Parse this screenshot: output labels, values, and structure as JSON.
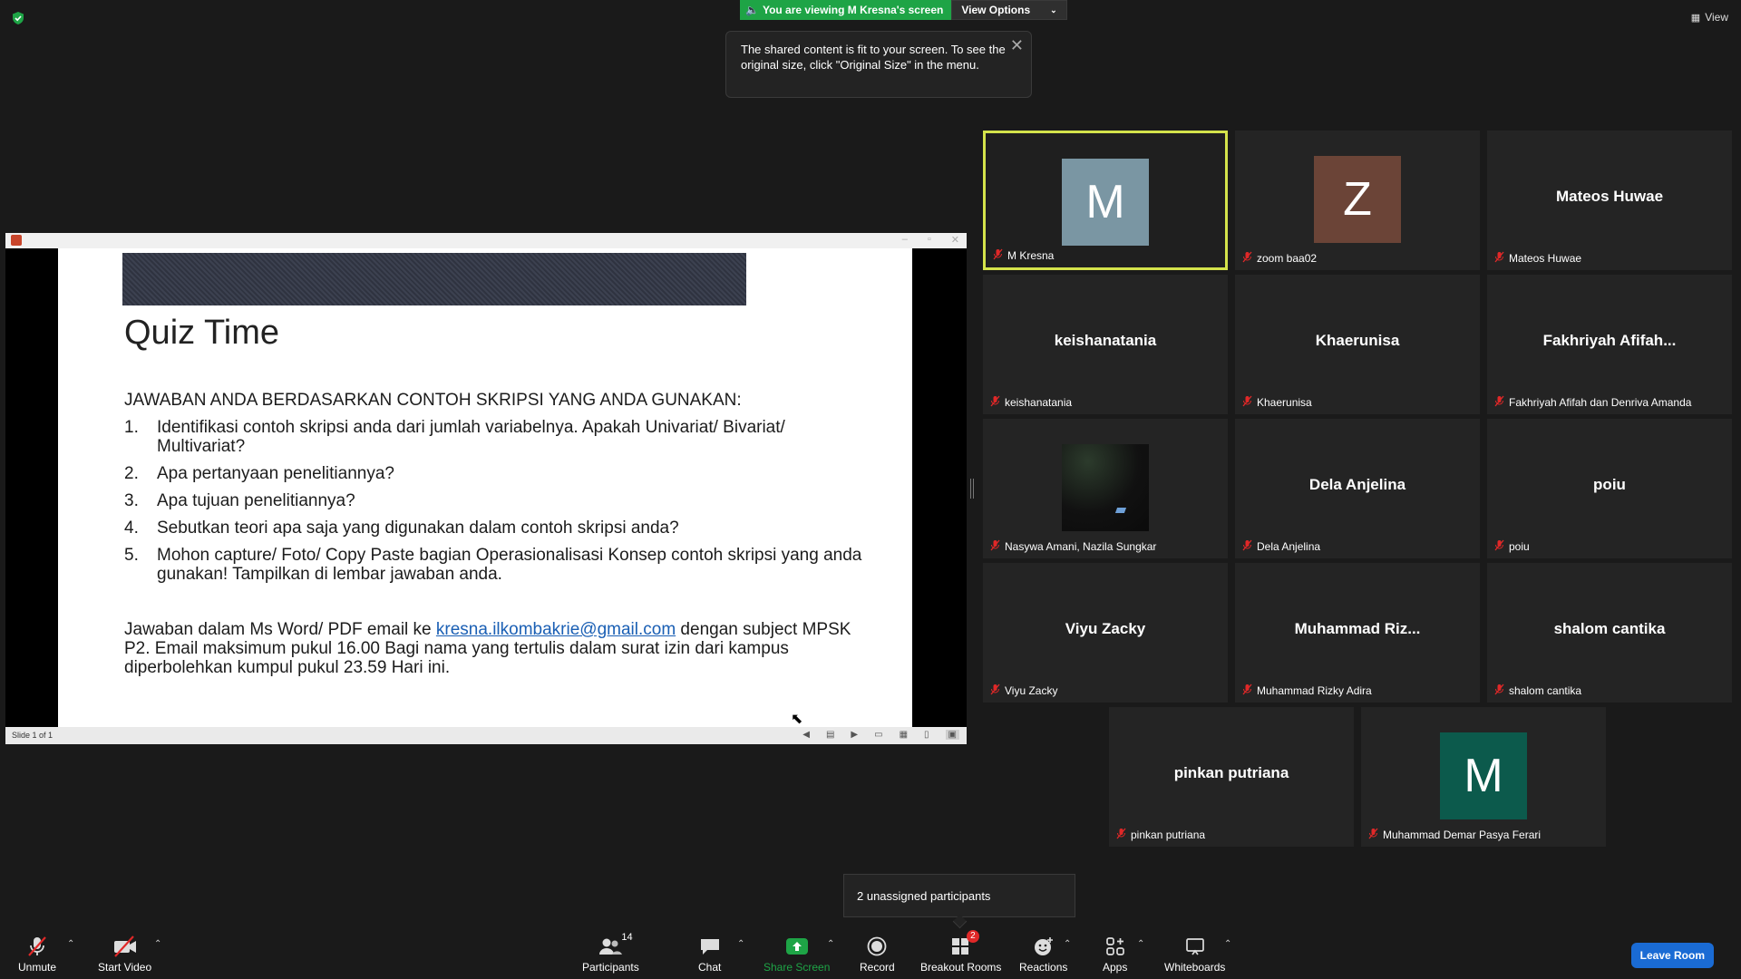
{
  "top": {
    "viewing_banner": "You are viewing M Kresna's screen",
    "view_options": "View Options",
    "view_label": "View"
  },
  "tooltip": {
    "text": "The shared content is fit to your screen. To see the original size, click \"Original Size\" in the menu."
  },
  "slide": {
    "title": "Quiz Time",
    "heading": "JAWABAN ANDA BERDASARKAN CONTOH SKRIPSI YANG ANDA GUNAKAN:",
    "items": [
      {
        "num": "1.",
        "text": "Identifikasi contoh skripsi anda dari jumlah variabelnya. Apakah Univariat/ Bivariat/ Multivariat?"
      },
      {
        "num": "2.",
        "text": "Apa pertanyaan penelitiannya?"
      },
      {
        "num": "3.",
        "text": "Apa tujuan penelitiannya?"
      },
      {
        "num": "4.",
        "text": "Sebutkan teori apa saja yang digunakan dalam contoh skripsi anda?"
      },
      {
        "num": "5.",
        "text": "Mohon capture/ Foto/ Copy Paste bagian Operasionalisasi Konsep contoh skripsi yang anda gunakan! Tampilkan di lembar jawaban anda."
      }
    ],
    "footer_before": "Jawaban dalam Ms Word/ PDF email ke ",
    "footer_link": "kresna.ilkombakrie@gmail.com",
    "footer_after": " dengan subject MPSK P2. Email maksimum pukul 16.00 Bagi nama yang tertulis dalam surat izin dari kampus diperbolehkan kumpul pukul 23.59 Hari ini.",
    "status": "Slide 1 of 1"
  },
  "participants": [
    {
      "center": "",
      "avatar": "M",
      "avatar_color": "#7a96a3",
      "label": "M Kresna",
      "active": true
    },
    {
      "center": "",
      "avatar": "Z",
      "avatar_color": "#6b4437",
      "label": "zoom baa02"
    },
    {
      "center": "Mateos Huwae",
      "label": "Mateos Huwae"
    },
    {
      "center": "keishanatania",
      "label": "keishanatania"
    },
    {
      "center": "Khaerunisa",
      "label": "Khaerunisa"
    },
    {
      "center": "Fakhriyah  Afifah...",
      "label": "Fakhriyah Afifah dan Denriva Amanda"
    },
    {
      "center": "",
      "photo": true,
      "label": "Nasywa Amani, Nazila Sungkar"
    },
    {
      "center": "Dela Anjelina",
      "label": "Dela Anjelina"
    },
    {
      "center": "poiu",
      "label": "poiu"
    },
    {
      "center": "Viyu Zacky",
      "label": "Viyu Zacky"
    },
    {
      "center": "Muhammad  Riz...",
      "label": "Muhammad Rizky Adira"
    },
    {
      "center": "shalom cantika",
      "label": "shalom cantika"
    },
    {
      "center": "pinkan putriana",
      "label": "pinkan putriana"
    },
    {
      "center": "",
      "avatar": "M",
      "avatar_color": "#0c5a4c",
      "label": "Muhammad Demar Pasya Ferari"
    }
  ],
  "popup": {
    "text": "2 unassigned participants"
  },
  "toolbar": {
    "unmute": "Unmute",
    "start_video": "Start Video",
    "participants": "Participants",
    "participants_count": "14",
    "chat": "Chat",
    "share_screen": "Share Screen",
    "record": "Record",
    "breakout_rooms": "Breakout Rooms",
    "breakout_badge": "2",
    "reactions": "Reactions",
    "apps": "Apps",
    "whiteboards": "Whiteboards",
    "leave_room": "Leave Room"
  },
  "colors": {
    "share_green": "#1ea446",
    "active_border": "#d4e34b",
    "leave_blue": "#1a6bd4",
    "mute_red": "#e02828"
  }
}
